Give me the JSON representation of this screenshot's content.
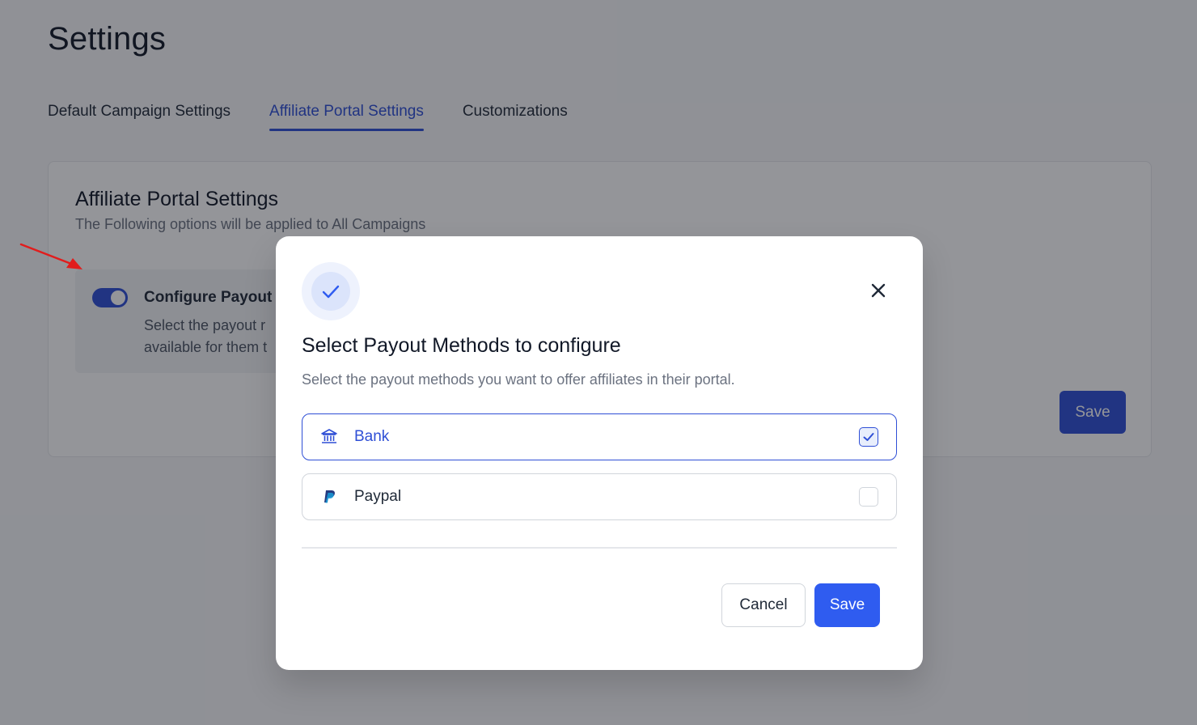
{
  "page": {
    "title": "Settings",
    "tabs": [
      {
        "label": "Default Campaign Settings",
        "active": false
      },
      {
        "label": "Affiliate Portal Settings",
        "active": true
      },
      {
        "label": "Customizations",
        "active": false
      }
    ],
    "card": {
      "title": "Affiliate Portal Settings",
      "subtitle": "The Following options will be applied to All Campaigns",
      "option": {
        "title": "Configure Payout r",
        "description_line1": "Select the payout r",
        "description_line2": "available for them t",
        "toggle_on": true
      },
      "save_label": "Save"
    }
  },
  "modal": {
    "icon": "check-icon",
    "title": "Select Payout Methods to configure",
    "subtitle": "Select the payout methods you want to offer affiliates in their portal.",
    "methods": [
      {
        "label": "Bank",
        "icon": "bank-icon",
        "checked": true
      },
      {
        "label": "Paypal",
        "icon": "paypal-icon",
        "checked": false
      }
    ],
    "cancel_label": "Cancel",
    "save_label": "Save"
  },
  "colors": {
    "accent": "#2f4fd6",
    "primary_button": "#2f5cf0",
    "overlay": "rgba(17,20,28,0.45)",
    "annotation_arrow": "#e11d1d"
  }
}
